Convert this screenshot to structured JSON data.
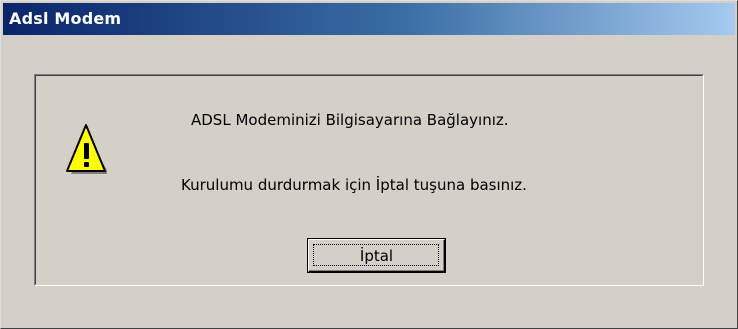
{
  "window": {
    "title": "Adsl Modem"
  },
  "dialog": {
    "message_line1": "ADSL Modeminizi Bilgisayarına Bağlayınız.",
    "message_line2": "Kurulumu durdurmak için İptal tuşuna basınız.",
    "icon": "warning-icon"
  },
  "buttons": {
    "cancel_label": "İptal"
  },
  "colors": {
    "title_gradient_start": "#0a246a",
    "title_gradient_end": "#a6caf0",
    "face": "#d4d0c8",
    "warning_yellow": "#ffff00"
  }
}
